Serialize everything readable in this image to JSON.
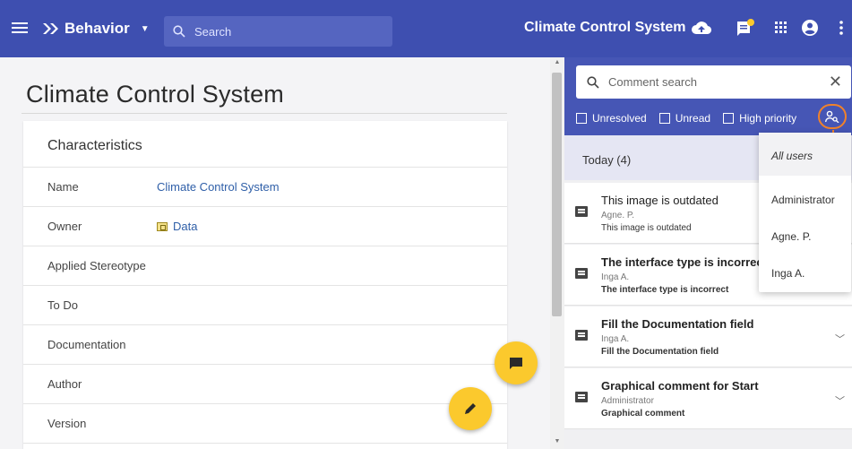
{
  "app": {
    "menu_icon": "hamburger-icon",
    "breadcrumb_icon": "double-chevron-icon",
    "breadcrumb_label": "Behavior",
    "search_placeholder": "Search",
    "project_title": "Climate Control System",
    "toolbar_icons": [
      "cloud-upload-icon",
      "notifications-icon",
      "apps-grid-icon",
      "account-icon",
      "more-vertical-icon"
    ],
    "accent": "#3e4fb0"
  },
  "main": {
    "page_title": "Climate Control System",
    "card_title": "Characteristics",
    "rows": [
      {
        "label": "Name",
        "value": "Climate Control System"
      },
      {
        "label": "Owner",
        "value": "Data"
      },
      {
        "label": "Applied Stereotype",
        "value": ""
      },
      {
        "label": "To Do",
        "value": ""
      },
      {
        "label": "Documentation",
        "value": ""
      },
      {
        "label": "Author",
        "value": ""
      },
      {
        "label": "Version",
        "value": ""
      }
    ]
  },
  "comments": {
    "search_placeholder": "Comment search",
    "filters": [
      "Unresolved",
      "Unread",
      "High priority"
    ],
    "group_label": "Today (4)",
    "items": [
      {
        "title": "This image is outdated",
        "author": "Agne. P.",
        "body": "This image is outdated"
      },
      {
        "title": "The interface type is incorrect",
        "author": "Inga A.",
        "body": "The interface type is incorrect"
      },
      {
        "title": "Fill the Documentation field",
        "author": "Inga A.",
        "body": "Fill the Documentation field"
      },
      {
        "title": "Graphical comment for Start",
        "author": "Administrator",
        "body": "Graphical comment"
      }
    ],
    "user_options": [
      "All users",
      "Administrator",
      "Agne. P.",
      "Inga A."
    ],
    "highlight_color": "#f0822b",
    "fab_color": "#fbc92d"
  }
}
